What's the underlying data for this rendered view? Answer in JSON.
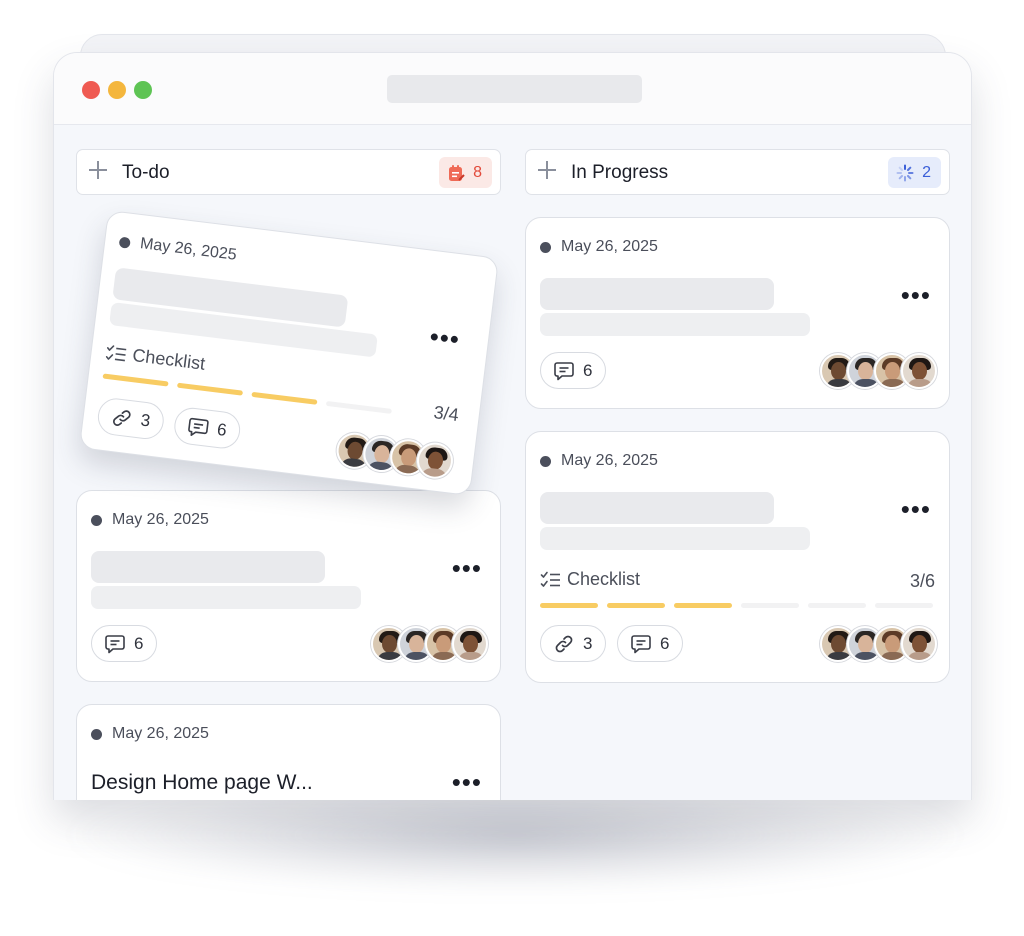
{
  "window": {
    "controls": [
      "close",
      "minimize",
      "maximize"
    ]
  },
  "columns": [
    {
      "title": "To-do",
      "count": "8",
      "badge_icon": "task-list-icon",
      "badge_color": "#e24a3b"
    },
    {
      "title": "In Progress",
      "count": "2",
      "badge_icon": "loading-spinner-icon",
      "badge_color": "#3a5ed8"
    }
  ],
  "cards": {
    "todo_dragged": {
      "date": "May 26, 2025",
      "checklist_label": "Checklist",
      "checklist_count": "3/4",
      "progress": 0.75,
      "links": "3",
      "comments": "6"
    },
    "todo_2": {
      "date": "May 26, 2025",
      "comments": "6"
    },
    "todo_3": {
      "date": "May 26, 2025",
      "title": "Design Home page W..."
    },
    "progress_1": {
      "date": "May 26, 2025",
      "comments": "6"
    },
    "progress_2": {
      "date": "May 26, 2025",
      "checklist_label": "Checklist",
      "checklist_count": "3/6",
      "progress": 0.5,
      "links": "3",
      "comments": "6"
    }
  },
  "colors": {
    "accent_progress": "#f8cc63",
    "window_bg": "#f5f7fb"
  }
}
